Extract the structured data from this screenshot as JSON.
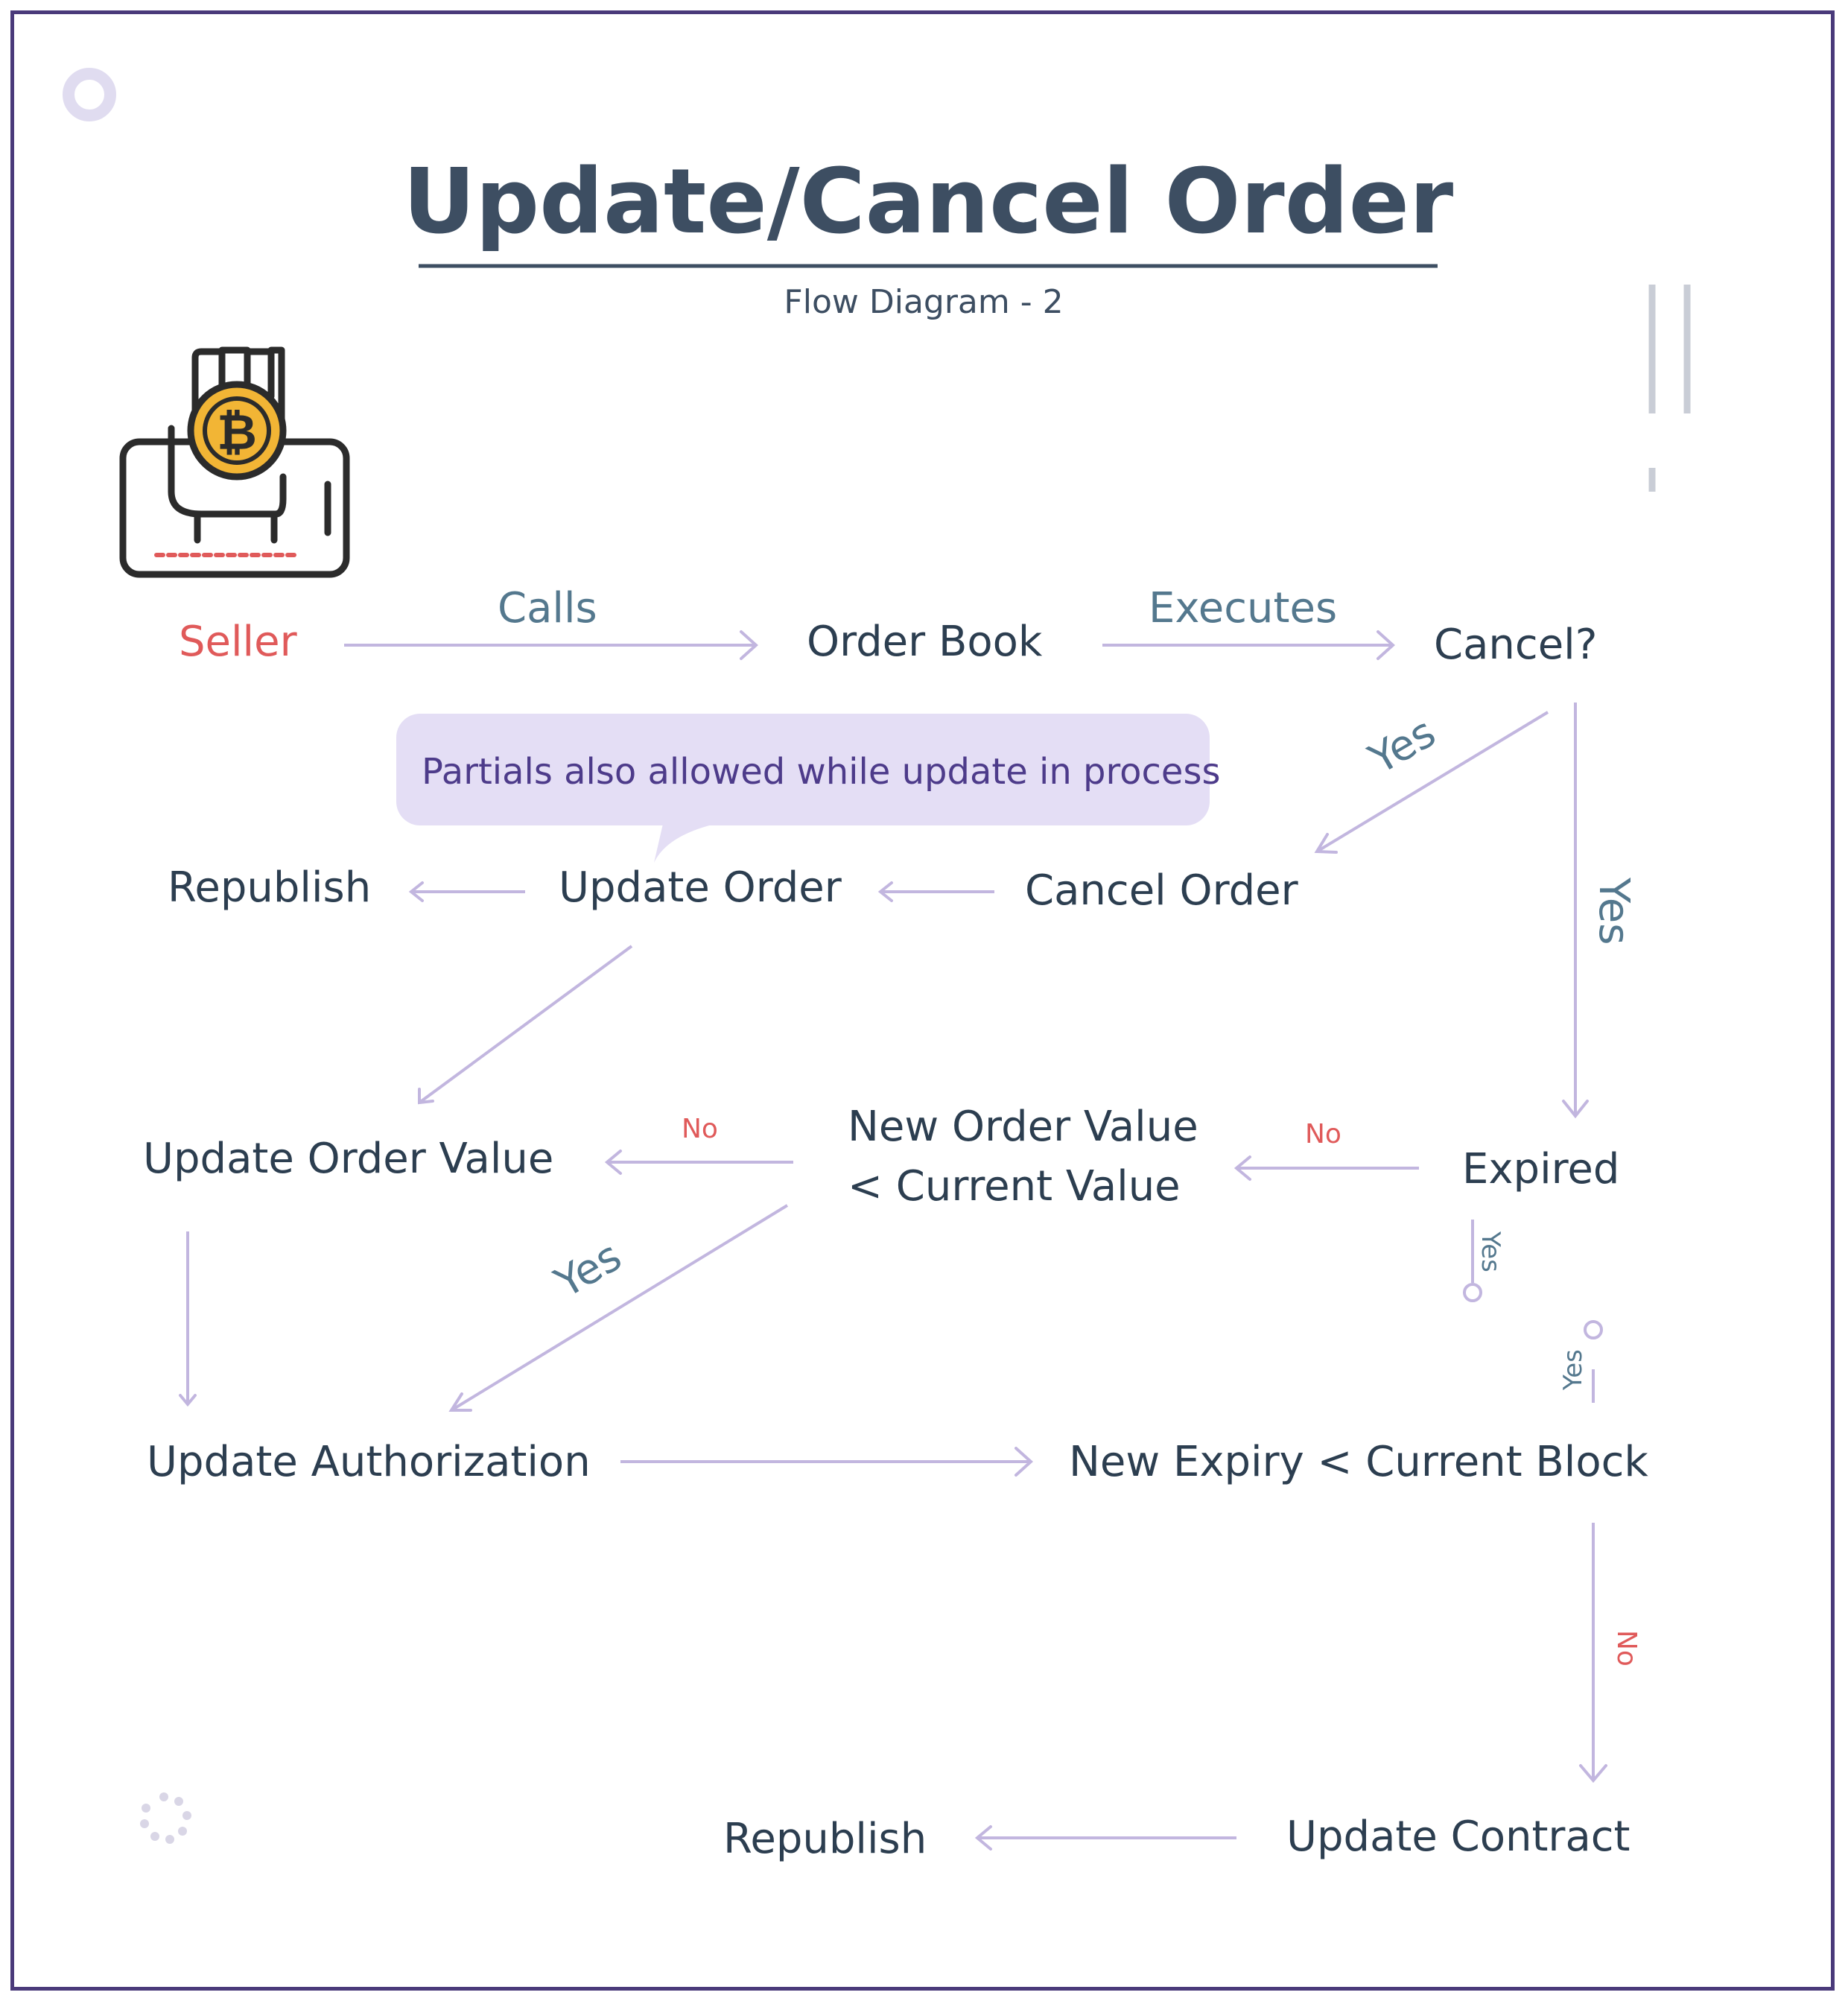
{
  "header": {
    "title": "Update/Cancel Order",
    "subtitle": "Flow Diagram - 2"
  },
  "colors": {
    "frame": "#4a3a7a",
    "title": "#3d4e62",
    "node_text": "#2c3e50",
    "seller": "#e05a5a",
    "edge_label": "#54788e",
    "no_label": "#e05a5a",
    "line": "#c2b6df",
    "callout_bg": "#e4def5",
    "callout_text": "#4d3b8a",
    "coin": "#f2b535"
  },
  "icons": {
    "seller_icon": "hand-holding-bitcoin-phone-icon",
    "bitcoin_symbol": "₿"
  },
  "callout": {
    "text": "Partials also allowed while update in process"
  },
  "nodes": {
    "seller": "Seller",
    "order_book": "Order Book",
    "cancel_q": "Cancel?",
    "republish_1": "Republish",
    "update_order": "Update Order",
    "cancel_order": "Cancel Order",
    "update_order_value": "Update Order Value",
    "new_order_value_line1": "New Order Value",
    "new_order_value_line2": "< Current Value",
    "expired": "Expired",
    "update_authorization": "Update Authorization",
    "new_expiry": "New Expiry < Current Block",
    "republish_2": "Republish",
    "update_contract": "Update Contract"
  },
  "edge_labels": {
    "calls": "Calls",
    "executes": "Executes",
    "yes_cancel_order": "Yes",
    "yes_expired": "Yes",
    "no_expired": "No",
    "no_value": "No",
    "yes_value": "Yes",
    "yes_expired_small": "Yes",
    "yes_block_small": "Yes",
    "no_block": "No"
  }
}
